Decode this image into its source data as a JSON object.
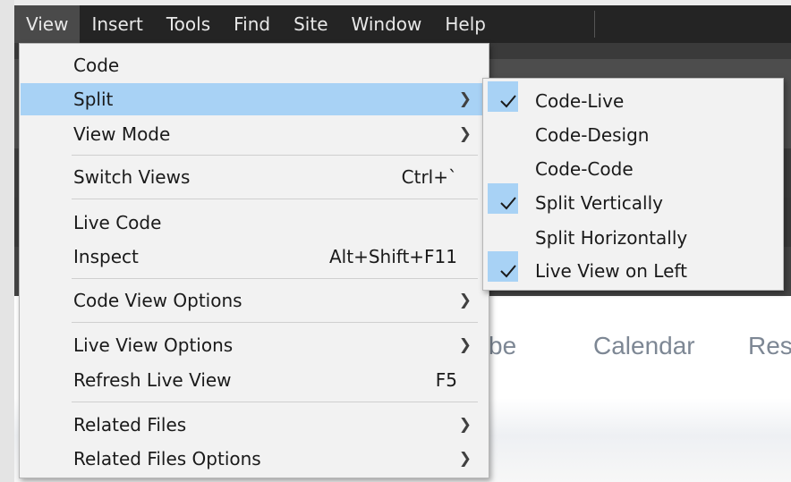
{
  "menubar": [
    "View",
    "Insert",
    "Tools",
    "Find",
    "Site",
    "Window",
    "Help"
  ],
  "view_menu": {
    "code": "Code",
    "split": "Split",
    "view_mode": "View Mode",
    "switch_views": "Switch Views",
    "switch_views_shortcut": "Ctrl+`",
    "live_code": "Live Code",
    "inspect": "Inspect",
    "inspect_shortcut": "Alt+Shift+F11",
    "code_view_options": "Code View Options",
    "live_view_options": "Live View Options",
    "refresh_live_view": "Refresh Live View",
    "refresh_shortcut": "F5",
    "related_files": "Related Files",
    "related_files_options": "Related Files Options"
  },
  "split_menu": [
    {
      "label": "Code-Live",
      "checked": true
    },
    {
      "label": "Code-Design",
      "checked": false
    },
    {
      "label": "Code-Code",
      "checked": false
    },
    {
      "label": "Split Vertically",
      "checked": true
    },
    {
      "label": "Split Horizontally",
      "checked": false
    },
    {
      "label": "Live View on Left",
      "checked": true
    }
  ],
  "site_nav": [
    "be",
    "Calendar",
    "Res"
  ],
  "colors": {
    "highlight": "#a8d2f5",
    "menubar": "#242424",
    "menu_bg": "#f2f2f2"
  }
}
